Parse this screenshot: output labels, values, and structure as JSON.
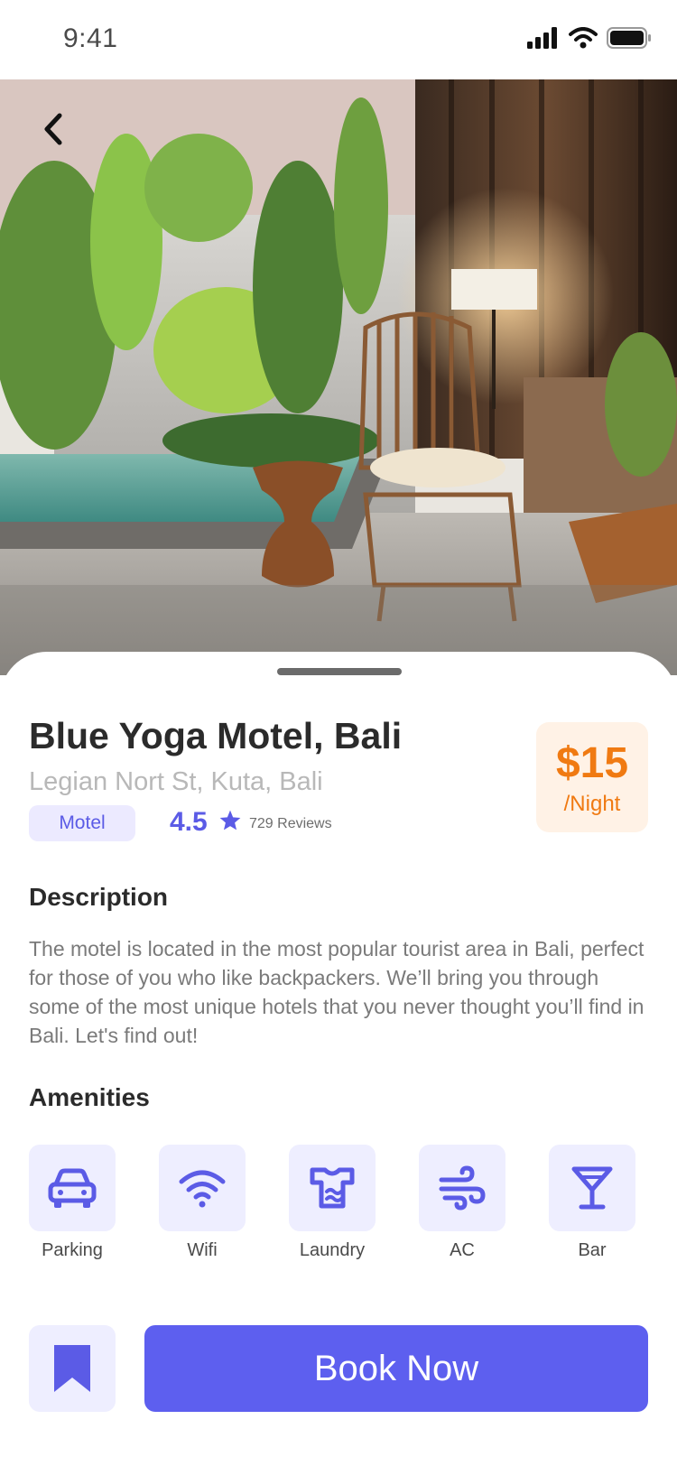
{
  "status_bar": {
    "time": "9:41",
    "icons": [
      "cellular-signal-icon",
      "wifi-icon",
      "battery-icon"
    ]
  },
  "hero": {
    "back_icon": "chevron-left-icon",
    "photo_subject": "motel room with plunge pool, wooden stool, rattan lounge chair and floor lamp"
  },
  "listing": {
    "name": "Blue Yoga Motel, Bali",
    "address": "Legian Nort St, Kuta, Bali",
    "type": "Motel",
    "rating": "4.5",
    "rating_icon": "star-icon",
    "reviews": "729 Reviews",
    "price": {
      "amount": "$15",
      "unit": "/Night"
    }
  },
  "description": {
    "heading": "Description",
    "text": "The motel is located in the most popular tourist area in Bali, perfect for those of you who like backpackers. We’ll bring you through some of the most unique hotels that you never thought you’ll find in Bali. Let's find out!"
  },
  "amenities": {
    "heading": "Amenities",
    "items": [
      {
        "label": "Parking",
        "icon": "car-icon"
      },
      {
        "label": "Wifi",
        "icon": "wifi-icon"
      },
      {
        "label": "Laundry",
        "icon": "laundry-icon"
      },
      {
        "label": "AC",
        "icon": "wind-icon"
      },
      {
        "label": "Bar",
        "icon": "cocktail-icon"
      }
    ]
  },
  "actions": {
    "bookmark_icon": "bookmark-icon",
    "book_label": "Book Now"
  },
  "colors": {
    "accent": "#5d5fef",
    "accent_light": "#eeeeff",
    "price": "#f07a12",
    "price_bg": "#fff2e6",
    "text_dark": "#2b2b2b",
    "text_muted": "#7a7a7a"
  }
}
